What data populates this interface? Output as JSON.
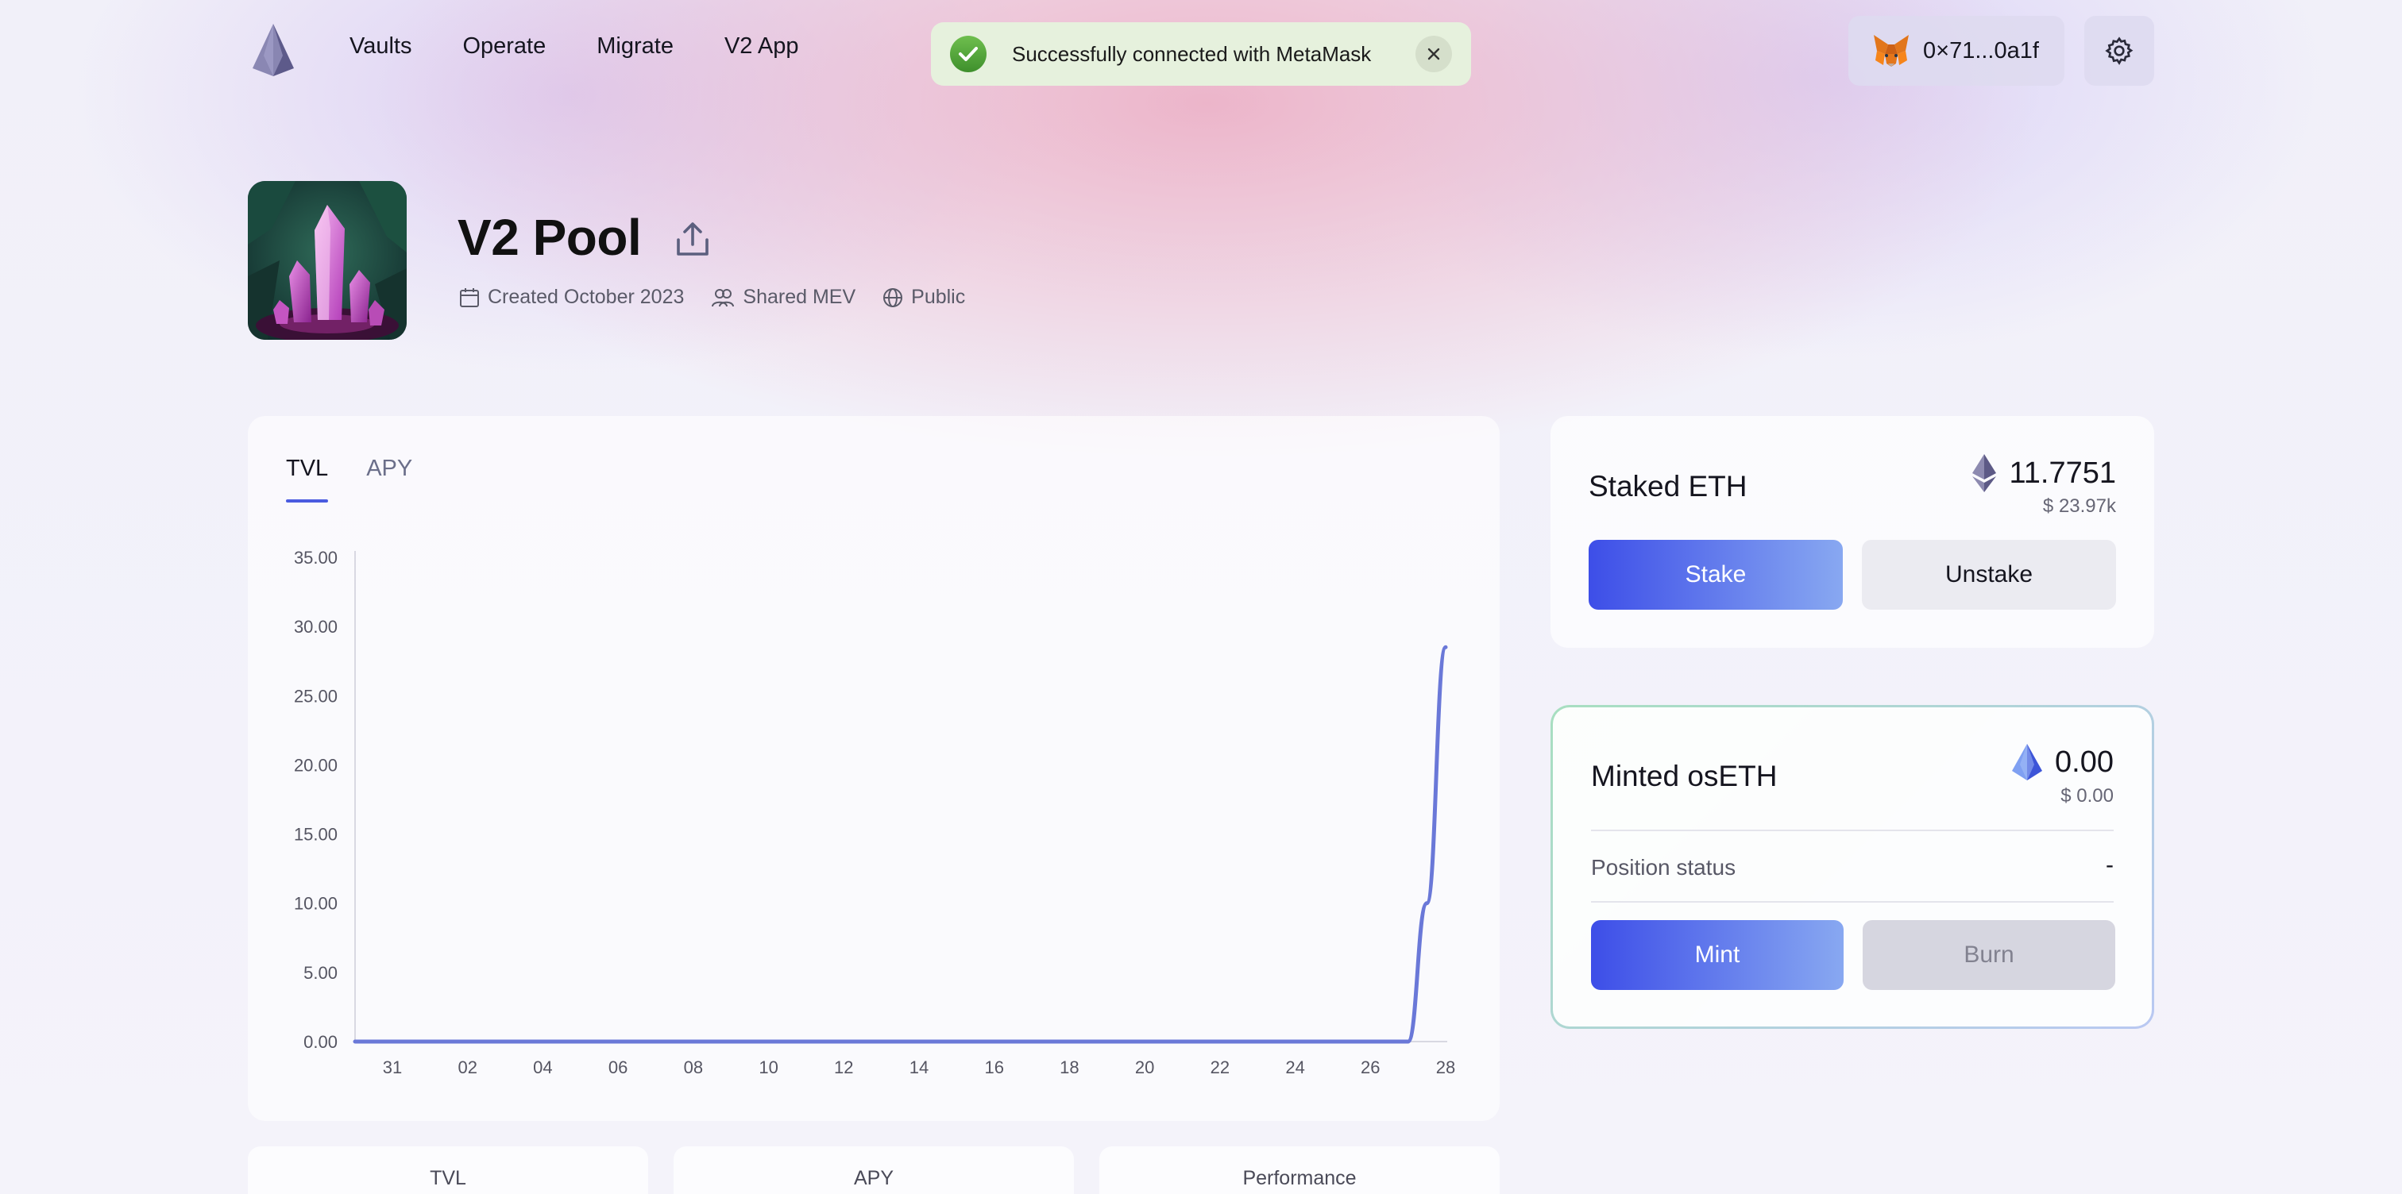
{
  "nav": {
    "items": [
      "Vaults",
      "Operate",
      "Migrate",
      "V2 App"
    ]
  },
  "toast": {
    "message": "Successfully connected with MetaMask",
    "status_color": "#5aa93c"
  },
  "wallet": {
    "address": "0×71...0a1f",
    "icon": "metamask-fox-icon"
  },
  "settings_icon": "gear-icon",
  "vault": {
    "name": "V2 Pool",
    "created": "Created October 2023",
    "mev": "Shared MEV",
    "visibility": "Public"
  },
  "chart": {
    "tabs": [
      "TVL",
      "APY"
    ],
    "active_tab": "TVL"
  },
  "chart_data": {
    "type": "line",
    "title": "",
    "xlabel": "",
    "ylabel": "",
    "ylim": [
      0,
      35
    ],
    "yticks": [
      "0.00",
      "5.00",
      "10.00",
      "15.00",
      "20.00",
      "25.00",
      "30.00",
      "35.00"
    ],
    "xticks": [
      "31",
      "02",
      "04",
      "06",
      "08",
      "10",
      "12",
      "14",
      "16",
      "18",
      "20",
      "22",
      "24",
      "26",
      "28"
    ],
    "grid": false,
    "line_color": "#6a78d8",
    "series": [
      {
        "x": [
          "31",
          "02",
          "04",
          "06",
          "08",
          "10",
          "12",
          "14",
          "16",
          "18",
          "20",
          "22",
          "24",
          "26",
          "27",
          "27.5",
          "28"
        ],
        "values": [
          0,
          0,
          0,
          0,
          0,
          0,
          0,
          0,
          0,
          0,
          0,
          0,
          0,
          0,
          0,
          10,
          28.5
        ]
      }
    ]
  },
  "stat_tabs": [
    "TVL",
    "APY",
    "Performance"
  ],
  "staked": {
    "title": "Staked ETH",
    "amount": "11.7751",
    "usd": "$ 23.97k",
    "stake_label": "Stake",
    "unstake_label": "Unstake"
  },
  "minted": {
    "title": "Minted osETH",
    "amount": "0.00",
    "usd": "$ 0.00",
    "position_status_label": "Position status",
    "position_status_value": "-",
    "mint_label": "Mint",
    "burn_label": "Burn"
  },
  "colors": {
    "accent": "#3d4ee8",
    "accent_light": "#88a8f1",
    "tab_underline": "#4a5be0"
  }
}
